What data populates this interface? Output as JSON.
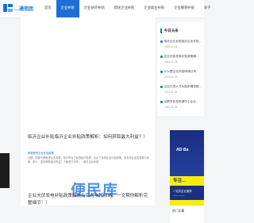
{
  "site": {
    "logo_text": "…通信团"
  },
  "nav": [
    {
      "label": "首页",
      "active": false
    },
    {
      "label": "企业补贴",
      "active": true
    },
    {
      "label": "企业扶持补贴",
      "active": false
    },
    {
      "label": "帮扶企业补贴",
      "active": false
    },
    {
      "label": "企业就业补贴",
      "active": false
    },
    {
      "label": "企业婚育补贴",
      "active": false
    },
    {
      "label": "关于",
      "active": false
    }
  ],
  "sidebar": {
    "title": "今日头条",
    "items": [
      {
        "title": "临沂企业补贴临沂企业补贴…",
        "date": "2024-01-03"
      },
      {
        "title": "企业光伏发电补贴政策解…",
        "date": "2024-01-03"
      },
      {
        "title": "什么是企业补贴申请公司…",
        "date": "2024-01-03"
      },
      {
        "title": "企业引进人才补贴申请流程…",
        "date": "2024-01-03"
      },
      {
        "title": "合肥市补贴申请中心企业…",
        "date": "2024-01-03"
      }
    ],
    "ad": {
      "label": "AD Ba",
      "slogan": "专注…",
      "sub": "一站式企业服务",
      "sub2": "—— ——"
    },
    "hot_title": "热门文章"
  },
  "articles": [
    {
      "title": "临沂企业补贴临沂企业补贴政策解析：如何获取最大利益？）",
      "meta": "家庭教育企业补贴政策",
      "summary": "近期，国家不断推进企业发展，临沂市为了促进经济发展，出台了多项企业补贴政策，来支持企业的发展与创新。那么，如何获取最大利益？下面进行分析。…临沂企业补贴"
    },
    {
      "title": "企业光伏发电补贴政策解读与实务申报攻略：一文帮你解析完整细节！）",
      "meta": "",
      "summary": ""
    }
  ],
  "watermark": "便民库"
}
